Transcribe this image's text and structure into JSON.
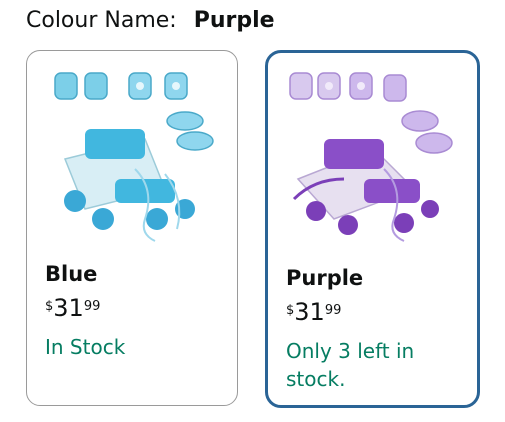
{
  "header": {
    "label": "Colour Name:",
    "value": "Purple"
  },
  "options": [
    {
      "name": "Blue",
      "currency": "$",
      "price_whole": "31",
      "price_fraction": "99",
      "availability": "In Stock",
      "selected": false,
      "accent": "#5bc0de"
    },
    {
      "name": "Purple",
      "currency": "$",
      "price_whole": "31",
      "price_fraction": "99",
      "availability": "Only 3 left in stock.",
      "selected": true,
      "accent": "#8e44ad"
    }
  ],
  "colors": {
    "stock_green": "#067d62",
    "selected_border": "#2a6496",
    "unselected_border": "#9a9a9a"
  }
}
